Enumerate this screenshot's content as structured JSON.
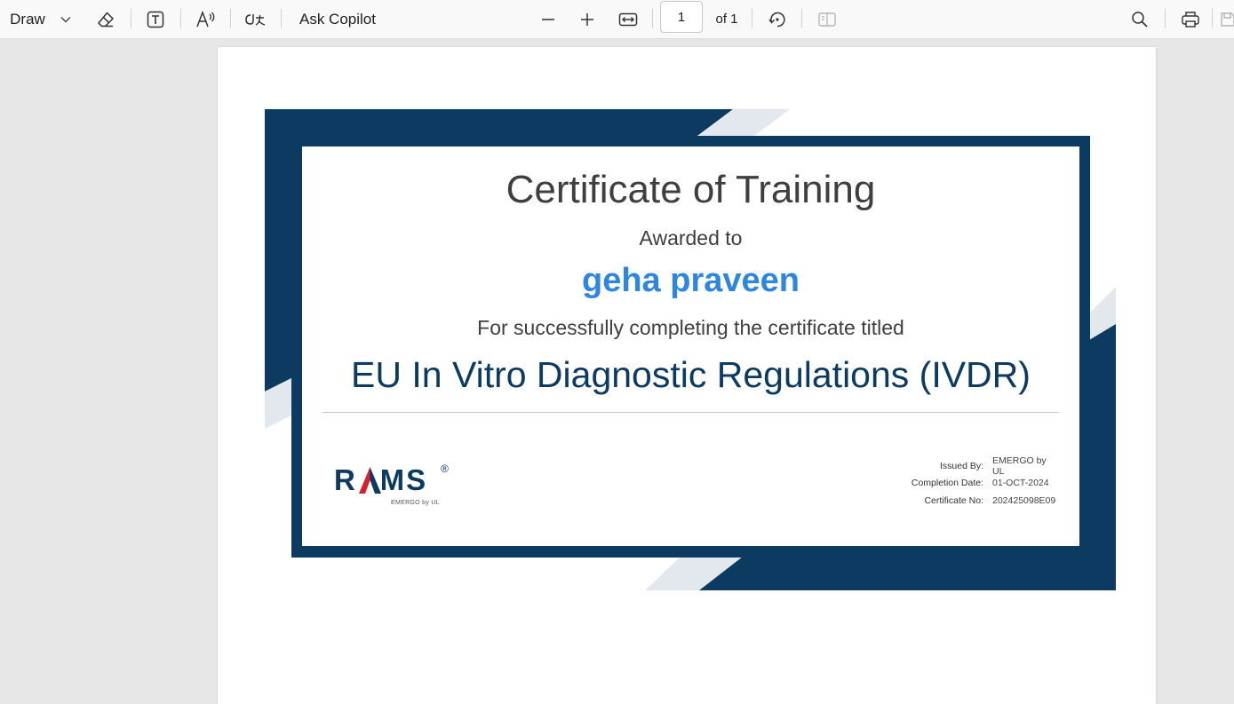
{
  "toolbar": {
    "draw_label": "Draw",
    "ask_copilot_label": "Ask Copilot",
    "page_number": "1",
    "page_count_label": "of 1",
    "icons": [
      "chevron-down-icon",
      "eraser-icon",
      "text-box-icon",
      "read-aloud-icon",
      "translate-icon",
      "zoom-out-icon",
      "zoom-in-icon",
      "fit-width-icon",
      "rotate-icon",
      "page-view-icon",
      "search-icon",
      "print-icon",
      "save-icon"
    ]
  },
  "certificate": {
    "title": "Certificate of Training",
    "awarded_to": "Awarded to",
    "recipient": "geha praveen",
    "completion_text": "For successfully completing the certificate titled",
    "course": "EU In Vitro Diagnostic Regulations (IVDR)",
    "logo": {
      "brand": "RAMS",
      "registered_mark": "®",
      "tagline": "EMERGO by UL"
    },
    "details": [
      {
        "label": "Issued By:",
        "value": "EMERGO by UL"
      },
      {
        "label": "Completion Date:",
        "value": "01-OCT-2024"
      },
      {
        "label": "Certificate No:",
        "value": "202425098E09"
      }
    ]
  },
  "colors": {
    "frame_navy": "#0c3a60",
    "accent_stripe": "#e3e8ee",
    "recipient_blue": "#2f86de",
    "logo_red": "#d5202e"
  }
}
